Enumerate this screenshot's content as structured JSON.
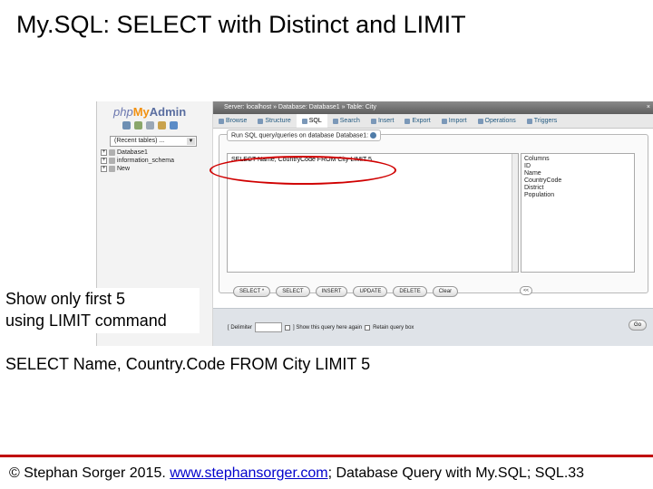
{
  "slide": {
    "title": "My.SQL: SELECT with Distinct and LIMIT",
    "callout_line1": "Show only first 5",
    "callout_line2": "using LIMIT command",
    "query": "SELECT Name, Country.Code FROM City LIMIT 5"
  },
  "footer": {
    "prefix": "© Stephan Sorger 2015. ",
    "link": "www.stephansorger.com",
    "suffix": "; Database Query with My.SQL;  SQL.33"
  },
  "pma": {
    "logo_php": "php",
    "logo_my": "My",
    "logo_admin": "Admin",
    "tables_select": "(Recent tables) ...",
    "databases": [
      {
        "pm": "+",
        "name": "Database1"
      },
      {
        "pm": "+",
        "name": "information_schema"
      },
      {
        "pm": "+",
        "name": "New"
      }
    ],
    "breadcrumb": "Server: localhost  »  Database: Database1  »  Table: City",
    "tabs": [
      {
        "label": "Browse",
        "icon": "browse-icon",
        "active": false
      },
      {
        "label": "Structure",
        "icon": "structure-icon",
        "active": false
      },
      {
        "label": "SQL",
        "icon": "sql-icon",
        "active": true
      },
      {
        "label": "Search",
        "icon": "search-icon",
        "active": false
      },
      {
        "label": "Insert",
        "icon": "insert-icon",
        "active": false
      },
      {
        "label": "Export",
        "icon": "export-icon",
        "active": false
      },
      {
        "label": "Import",
        "icon": "import-icon",
        "active": false
      },
      {
        "label": "Operations",
        "icon": "operations-icon",
        "active": false
      },
      {
        "label": "Triggers",
        "icon": "triggers-icon",
        "active": false
      }
    ],
    "legend": "Run SQL query/queries on database Database1:",
    "query_text": "SELECT Name, CountryCode FROM City LIMIT 5",
    "columns_label": "Columns",
    "columns": [
      "ID",
      "Name",
      "CountryCode",
      "District",
      "Population"
    ],
    "buttons": [
      "SELECT *",
      "SELECT",
      "INSERT",
      "UPDATE",
      "DELETE",
      "Clear"
    ],
    "pager": "<<",
    "delimiter_label": "[ Delimiter",
    "delimiter_value": ";",
    "show_again_label": "] Show this query here again",
    "retain_box_label": "Retain query box",
    "go": "Go",
    "close_glyph": "×"
  }
}
